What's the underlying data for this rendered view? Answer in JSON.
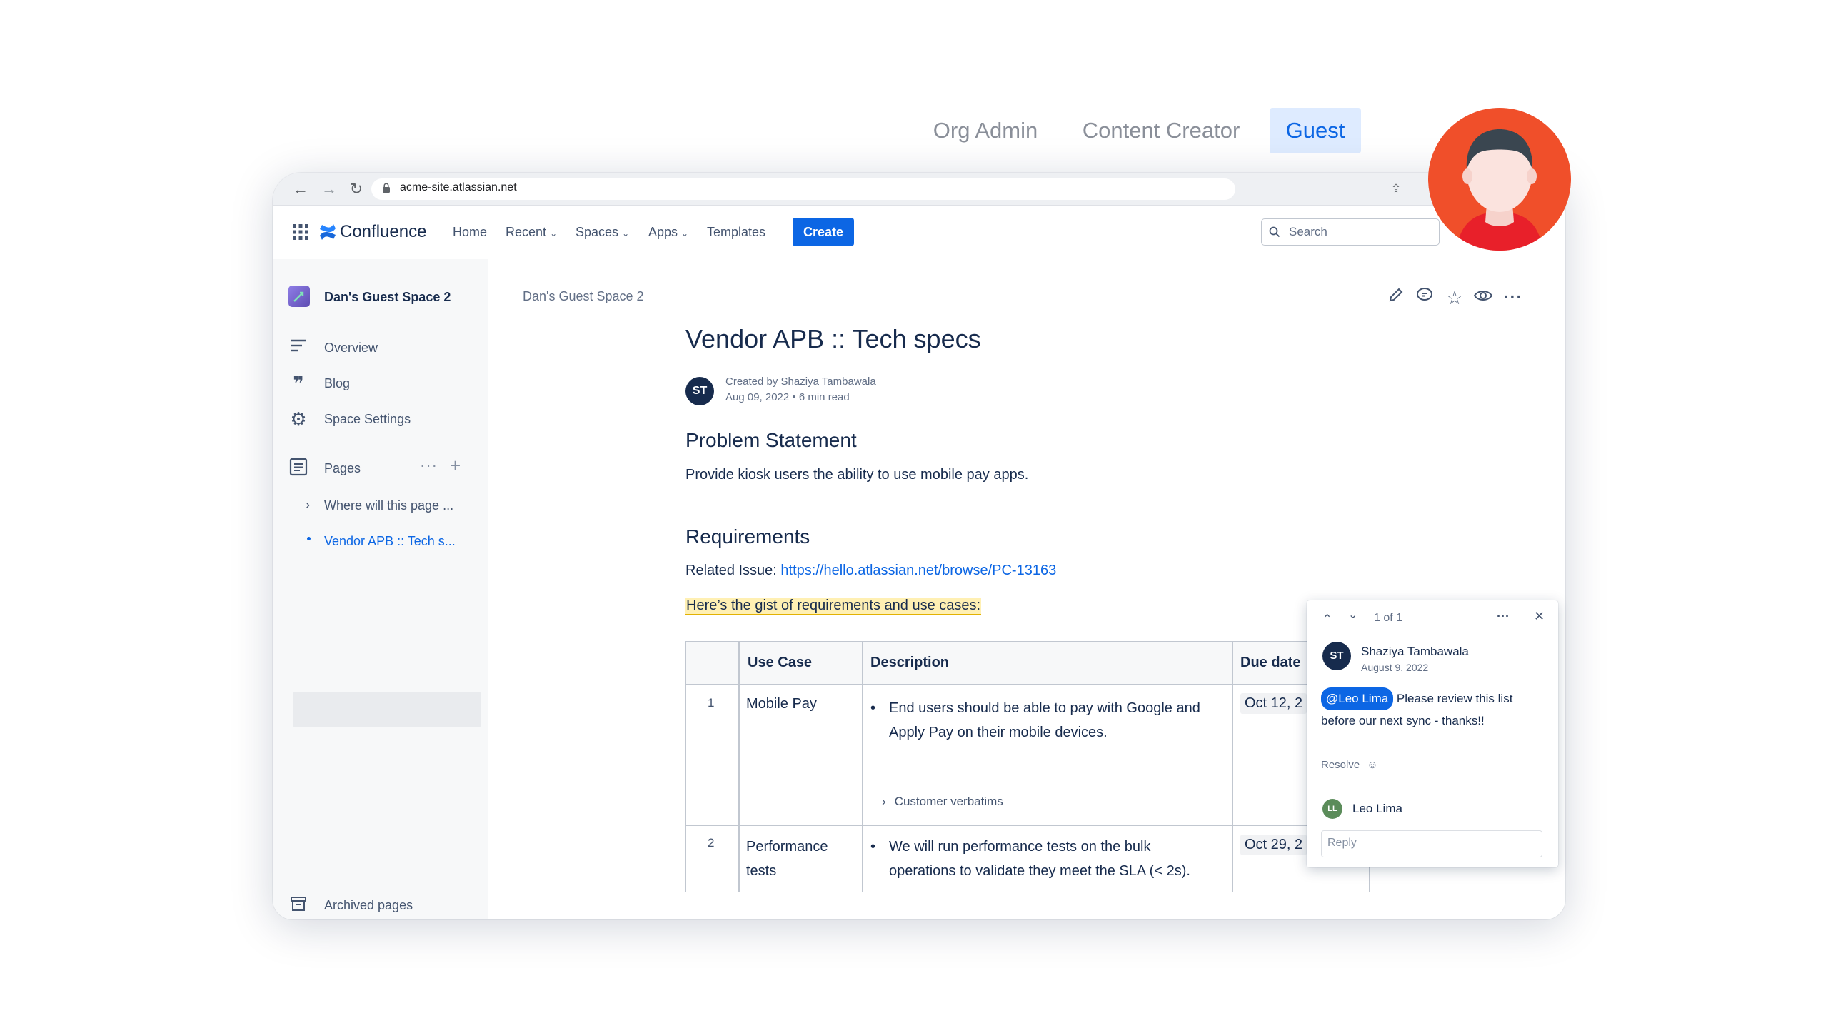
{
  "roles": {
    "org_admin": "Org Admin",
    "content_creator": "Content Creator",
    "guest": "Guest"
  },
  "browser": {
    "url": "acme-site.atlassian.net"
  },
  "app": {
    "product_name": "Confluence",
    "nav": {
      "home": "Home",
      "recent": "Recent",
      "spaces": "Spaces",
      "apps": "Apps",
      "templates": "Templates"
    },
    "create_label": "Create",
    "search_placeholder": "Search"
  },
  "sidebar": {
    "space_name": "Dan's Guest Space 2",
    "items": [
      {
        "label": "Overview",
        "icon": "overview-icon"
      },
      {
        "label": "Blog",
        "icon": "blog-quote-icon"
      },
      {
        "label": "Space Settings",
        "icon": "gear-icon"
      }
    ],
    "pages_label": "Pages",
    "page_tree": [
      {
        "label": "Where will this page ..."
      },
      {
        "label": "Vendor APB :: Tech s..."
      }
    ],
    "archived_label": "Archived pages"
  },
  "page": {
    "breadcrumb": "Dan's Guest Space 2",
    "title": "Vendor APB :: Tech specs",
    "author_initials": "ST",
    "created_by": "Created by Shaziya Tambawala",
    "date": "Aug 09, 2022",
    "read_time": "6 min read",
    "problem_heading": "Problem Statement",
    "problem_text": "Provide kiosk users the ability to use mobile pay apps.",
    "requirements_heading": "Requirements",
    "related_label": "Related Issue: ",
    "related_link": "https://hello.atlassian.net/browse/PC-13163",
    "highlight_text": "Here’s the gist of requirements and use cases:"
  },
  "table": {
    "headers": [
      "Use Case",
      "Description",
      "Due date"
    ],
    "rows": [
      {
        "num": "1",
        "use_case": "Mobile Pay",
        "description": "End users should be able to pay with Google and Apply Pay on their mobile devices.",
        "expand_label": "Customer verbatims",
        "due": "Oct 12, 2"
      },
      {
        "num": "2",
        "use_case": "Performance tests",
        "description": "We will run performance tests on the bulk operations to validate they meet the SLA (< 2s).",
        "due": "Oct 29, 2"
      }
    ]
  },
  "comment": {
    "counter": "1 of 1",
    "author": "Shaziya Tambawala",
    "author_initials": "ST",
    "date": "August 9, 2022",
    "mention": "@Leo Lima",
    "text": " Please review this list before our next sync - thanks!!",
    "resolve_label": "Resolve",
    "reply_user": "Leo Lima",
    "reply_initials": "LL",
    "reply_placeholder": "Reply"
  },
  "colors": {
    "accent": "#0c66e4",
    "avatar_bg": "#f04f2a",
    "highlight": "#fff0b3",
    "highlight_underline": "#e2b203",
    "reply_avatar": "#5b8c5a"
  }
}
